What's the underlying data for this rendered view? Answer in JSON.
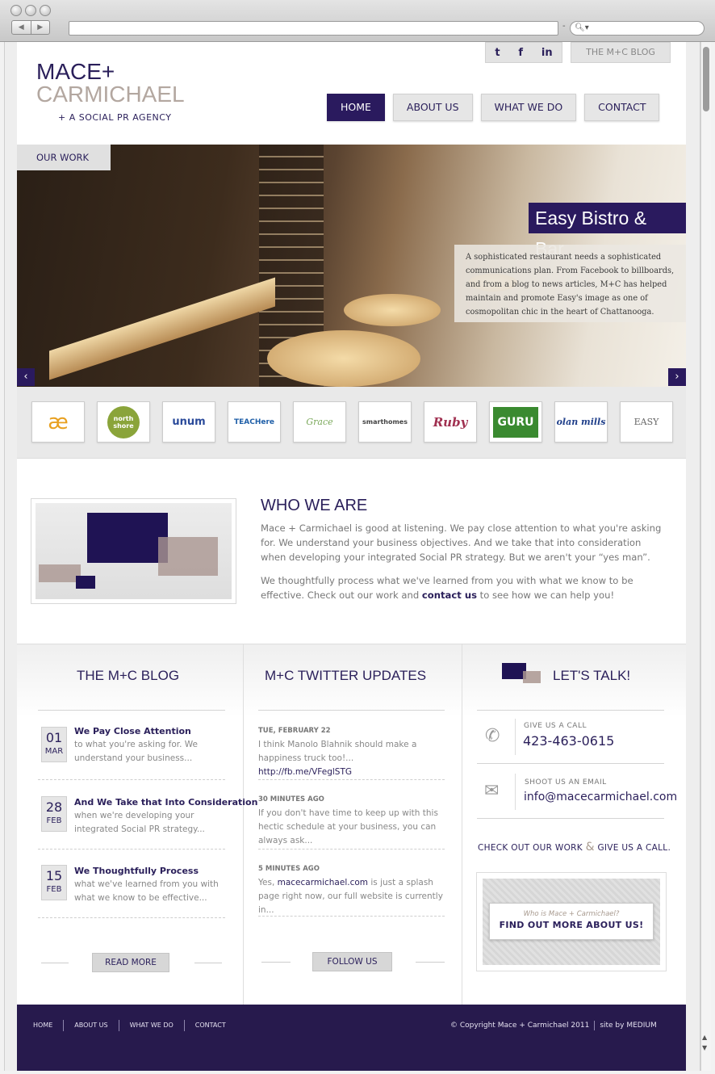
{
  "browser": {
    "search_icon": "magnifier-icon"
  },
  "header": {
    "logo_line1": "MACE+",
    "logo_line2": "CARMICHAEL",
    "tagline": "+ A SOCIAL PR AGENCY",
    "social": {
      "twitter": "t",
      "facebook": "f",
      "linkedin": "in"
    },
    "blog_tab": "THE M+C BLOG",
    "nav": [
      {
        "label": "HOME",
        "active": true
      },
      {
        "label": "ABOUT US",
        "active": false
      },
      {
        "label": "WHAT WE DO",
        "active": false
      },
      {
        "label": "CONTACT",
        "active": false
      }
    ]
  },
  "hero": {
    "tab": "OUR WORK",
    "title": "Easy Bistro & Bar",
    "text": "A sophisticated restaurant needs a sophisticated communications plan. From Facebook to billboards, and from a blog to news articles, M+C has helped maintain and promote Easy's image as one of cosmopolitan chic in the heart of Chattanooga.",
    "prev": "‹",
    "next": "›"
  },
  "clients": [
    "æ",
    "north shore",
    "unum",
    "TEACHere",
    "Grace",
    "smarthomes",
    "Ruby",
    "GURU",
    "olan mills",
    "EASY"
  ],
  "who": {
    "title": "WHO WE ARE",
    "p1": "Mace + Carmichael is good at listening. We pay close attention to what you're asking for. We understand your business objectives. And we take that into consideration when developing your integrated Social PR strategy. But we aren't your “yes man”.",
    "p2_before": "We thoughtfully process what we've learned from you with what we know to be effective. Check out our work and ",
    "p2_link": "contact us",
    "p2_after": " to see how we can help you!"
  },
  "blog": {
    "title": "THE M+C BLOG",
    "posts": [
      {
        "day": "01",
        "month": "MAR",
        "title": "We Pay Close Attention",
        "body": "to what you're asking for. We understand your business..."
      },
      {
        "day": "28",
        "month": "FEB",
        "title": "And We Take that Into Consideration",
        "body": "when we're developing your integrated Social PR strategy..."
      },
      {
        "day": "15",
        "month": "FEB",
        "title": "We Thoughtfully Process",
        "body": "what we've learned from you with what we know to be effective..."
      }
    ],
    "button": "READ MORE"
  },
  "twitter": {
    "title": "M+C TWITTER UPDATES",
    "tweets": [
      {
        "date": "TUE, FEBRUARY 22",
        "body": "I think Manolo Blahnik should make a happiness truck too!...",
        "link": "http://fb.me/VFeglSTG"
      },
      {
        "date": "30 MINUTES AGO",
        "body": "If you don't have time to keep up with this hectic schedule at your business, you can always ask..."
      },
      {
        "date": "5 MINUTES AGO",
        "body_before": "Yes, ",
        "link": "macecarmichael.com",
        "body_after": " is just a splash page right now, our full website is currently in..."
      }
    ],
    "button": "FOLLOW US"
  },
  "talk": {
    "title": "LET'S TALK!",
    "call_label": "GIVE US A CALL",
    "phone": "423-463-0615",
    "email_label": "SHOOT US AN EMAIL",
    "email": "info@macecarmichael.com",
    "cta_left": "CHECK OUT OUR WORK",
    "cta_amp": "&",
    "cta_right": "GIVE US A CALL.",
    "find_small": "Who is Mace + Carmichael?",
    "find_big": "FIND OUT MORE ABOUT US!"
  },
  "footer": {
    "nav": [
      "HOME",
      "ABOUT US",
      "WHAT WE DO",
      "CONTACT"
    ],
    "copyright": "© Copyright Mace + Carmichael 2011",
    "site_by": "site by MEDIUM"
  },
  "colors": {
    "brand_purple": "#2a1a5e",
    "taupe": "#b3a7a0",
    "footer": "#271a4d"
  }
}
